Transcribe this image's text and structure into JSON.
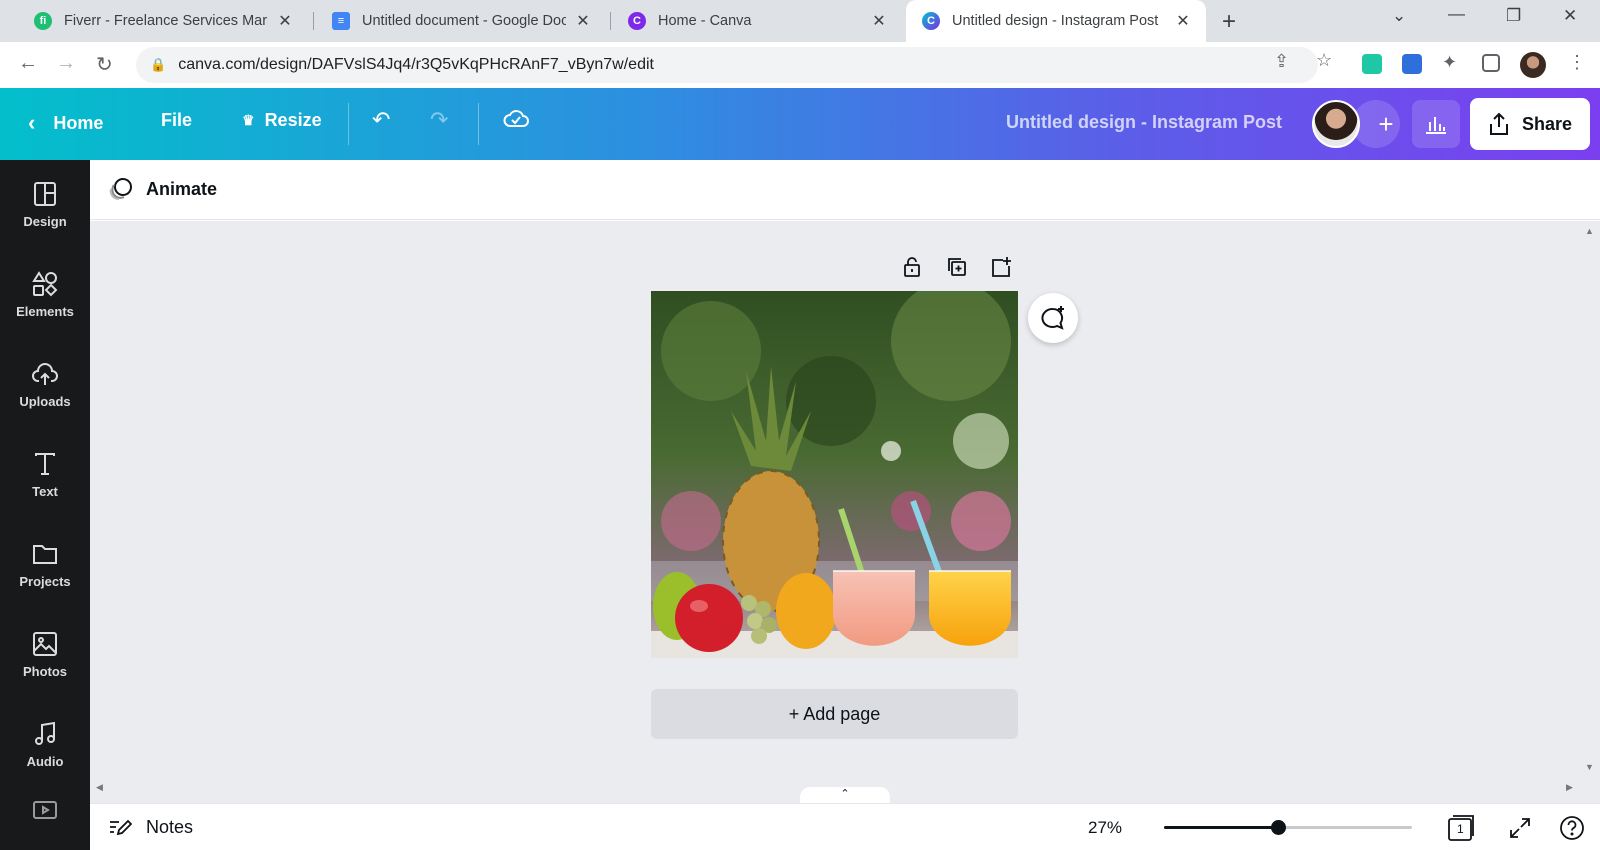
{
  "browser": {
    "tabs": [
      {
        "title": "Fiverr - Freelance Services Marke",
        "favicon_color": "#1dbf73",
        "favicon_letter": "fi",
        "active": false
      },
      {
        "title": "Untitled document - Google Doc",
        "favicon_color": "#4285f4",
        "favicon_letter": "≡",
        "active": false
      },
      {
        "title": "Home - Canva",
        "favicon_color": "#7d2ae8",
        "favicon_letter": "C",
        "active": false
      },
      {
        "title": "Untitled design - Instagram Post",
        "favicon_color": "#00c4cc",
        "favicon_letter": "C",
        "active": true
      }
    ],
    "url": "canva.com/design/DAFVslS4Jq4/r3Q5vKqPHcRAnF7_vByn7w/edit"
  },
  "header": {
    "home_label": "Home",
    "file_label": "File",
    "resize_label": "Resize",
    "doc_title": "Untitled design - Instagram Post",
    "share_label": "Share",
    "gradient": [
      "#03bfcb",
      "#7b3ff0"
    ]
  },
  "sidebar": {
    "items": [
      {
        "label": "Design",
        "icon": "layout-icon"
      },
      {
        "label": "Elements",
        "icon": "shapes-icon"
      },
      {
        "label": "Uploads",
        "icon": "cloud-upload-icon"
      },
      {
        "label": "Text",
        "icon": "text-icon"
      },
      {
        "label": "Projects",
        "icon": "folder-icon"
      },
      {
        "label": "Photos",
        "icon": "image-icon"
      },
      {
        "label": "Audio",
        "icon": "music-icon"
      }
    ]
  },
  "context_bar": {
    "animate_label": "Animate"
  },
  "canvas": {
    "add_page_label": "+ Add page"
  },
  "footer": {
    "notes_label": "Notes",
    "zoom": "27%",
    "zoom_fraction": 0.27,
    "page_count": "1"
  }
}
